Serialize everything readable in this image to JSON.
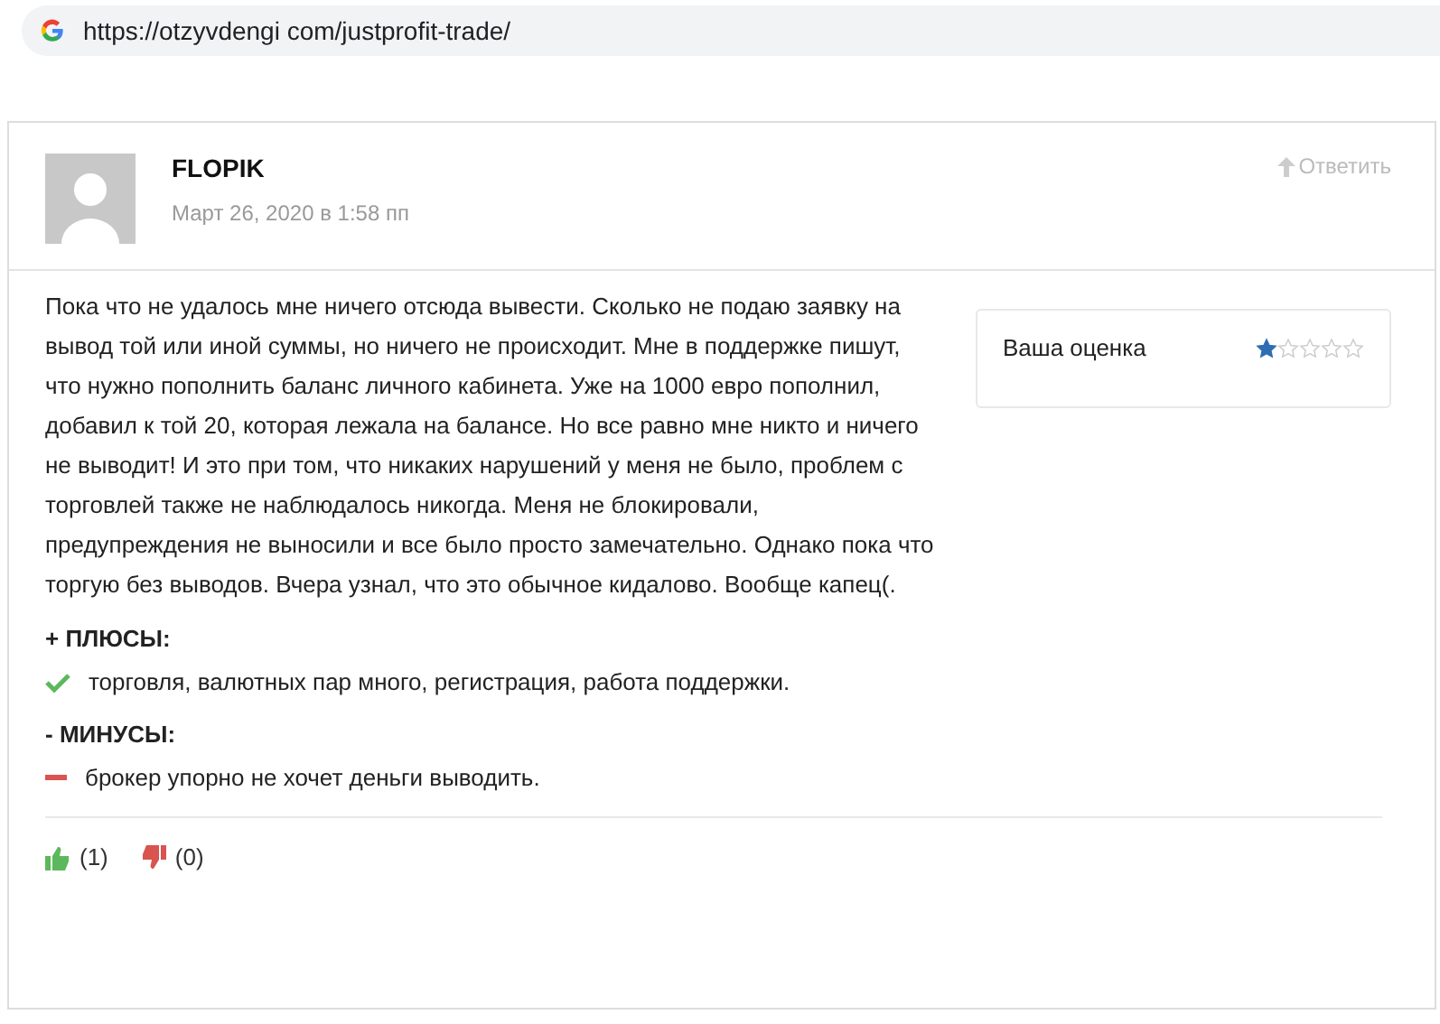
{
  "address_bar": {
    "url": "https://otzyvdengi com/justprofit-trade/"
  },
  "review": {
    "author": "FLOPIK",
    "date": "Март 26, 2020 в 1:58 пп",
    "reply": "Ответить",
    "text": "Пока что не удалось мне ничего отсюда вывести. Сколько не подаю заявку на вывод той или иной суммы, но ничего не происходит. Мне в поддержке пишут, что нужно пополнить баланс личного кабинета. Уже на 1000 евро пополнил, добавил к той 20, которая лежала на балансе. Но все равно мне никто и ничего не выводит! И это при том, что никаких нарушений у меня не было, проблем с торговлей также не наблюдалось никогда. Меня не блокировали, предупреждения не выносили и все было просто замечательно. Однако пока что торгую без выводов. Вчера узнал, что это обычное кидалово. Вообще капец(.",
    "rating": {
      "label": "Ваша оценка",
      "stars": 1
    },
    "sections": [
      {
        "kind": "pros",
        "title": "+ ПЛЮСЫ:",
        "text": "торговля, валютных пар много, регистрация, работа поддержки."
      },
      {
        "kind": "cons",
        "title": "- МИНУСЫ:",
        "text": "брокер упорно не хочет деньги выводить."
      }
    ],
    "votes": [
      {
        "kind": "up",
        "count": "(1)"
      },
      {
        "kind": "down",
        "count": "(0)"
      }
    ]
  }
}
